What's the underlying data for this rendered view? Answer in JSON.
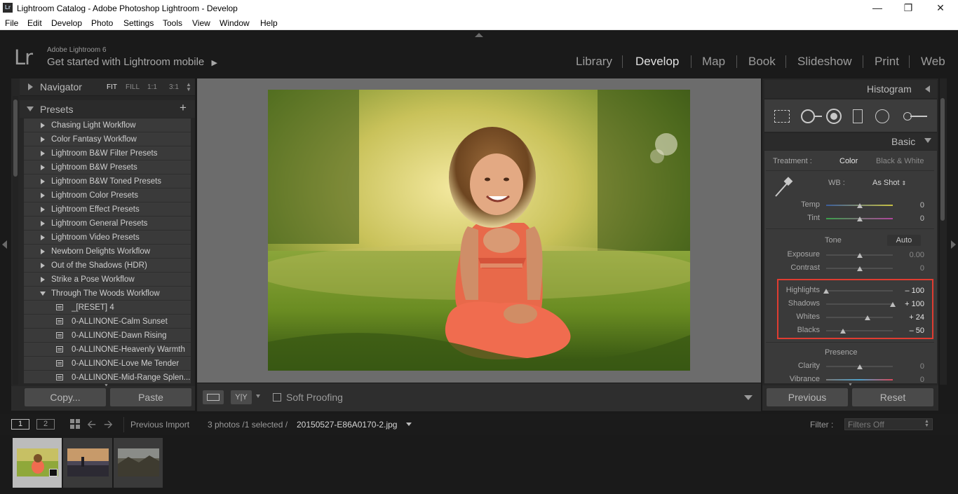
{
  "window": {
    "app_icon": "Lr",
    "title": "Lightroom Catalog - Adobe Photoshop Lightroom - Develop"
  },
  "menu": [
    "File",
    "Edit",
    "Develop",
    "Photo",
    "Settings",
    "Tools",
    "View",
    "Window",
    "Help"
  ],
  "identity": {
    "logo": "Lr",
    "product": "Adobe Lightroom 6",
    "mobile_prompt": "Get started with Lightroom mobile"
  },
  "modules": [
    "Library",
    "Develop",
    "Map",
    "Book",
    "Slideshow",
    "Print",
    "Web"
  ],
  "active_module": "Develop",
  "navigator": {
    "title": "Navigator",
    "zoom": [
      "FIT",
      "FILL",
      "1:1",
      "3:1"
    ]
  },
  "presets": {
    "title": "Presets",
    "add": "+",
    "folders": [
      "Chasing Light Workflow",
      "Color Fantasy Workflow",
      "Lightroom B&W Filter Presets",
      "Lightroom B&W Presets",
      "Lightroom B&W Toned Presets",
      "Lightroom Color Presets",
      "Lightroom Effect Presets",
      "Lightroom General Presets",
      "Lightroom Video Presets",
      "Newborn Delights Workflow",
      "Out of the Shadows (HDR)",
      "Strike a Pose Workflow",
      "Through The Woods Workflow"
    ],
    "items": [
      "_[RESET] 4",
      "0-ALLINONE-Calm Sunset",
      "0-ALLINONE-Dawn Rising",
      "0-ALLINONE-Heavenly Warmth",
      "0-ALLINONE-Love Me Tender",
      "0-ALLINONE-Mid-Range Splen..."
    ]
  },
  "left_buttons": {
    "copy": "Copy...",
    "paste": "Paste"
  },
  "toolbar": {
    "soft_proofing": "Soft Proofing",
    "compare": "Y|Y"
  },
  "right": {
    "histogram": "Histogram",
    "basic": "Basic",
    "treatment_label": "Treatment :",
    "treatment_color": "Color",
    "treatment_bw": "Black & White",
    "wb_label": "WB :",
    "wb_value": "As Shot",
    "temp_label": "Temp",
    "temp_value": "0",
    "tint_label": "Tint",
    "tint_value": "0",
    "tone_label": "Tone",
    "auto": "Auto",
    "exposure_label": "Exposure",
    "exposure_value": "0.00",
    "contrast_label": "Contrast",
    "contrast_value": "0",
    "highlights_label": "Highlights",
    "highlights_value": "– 100",
    "shadows_label": "Shadows",
    "shadows_value": "+ 100",
    "whites_label": "Whites",
    "whites_value": "+ 24",
    "blacks_label": "Blacks",
    "blacks_value": "– 50",
    "presence_label": "Presence",
    "clarity_label": "Clarity",
    "clarity_value": "0",
    "vibrance_label": "Vibrance",
    "vibrance_value": "0"
  },
  "slider_levels": {
    "temp": 0.5,
    "tint": 0.5,
    "exposure": 0.5,
    "contrast": 0.5,
    "highlights": 0.0,
    "shadows": 1.0,
    "whites": 0.62,
    "blacks": 0.25,
    "clarity": 0.5,
    "vibrance": 0.5
  },
  "right_buttons": {
    "previous": "Previous",
    "reset": "Reset"
  },
  "filmstrip_bar": {
    "view1": "1",
    "view2": "2",
    "source": "Previous Import",
    "count": "3 photos /1 selected /",
    "filename": "20150527-E86A0170-2.jpg",
    "filter_label": "Filter :",
    "filter_value": "Filters Off"
  },
  "colors": {
    "highlight_box": "#e03c31",
    "accent": "#e0e0e0"
  }
}
